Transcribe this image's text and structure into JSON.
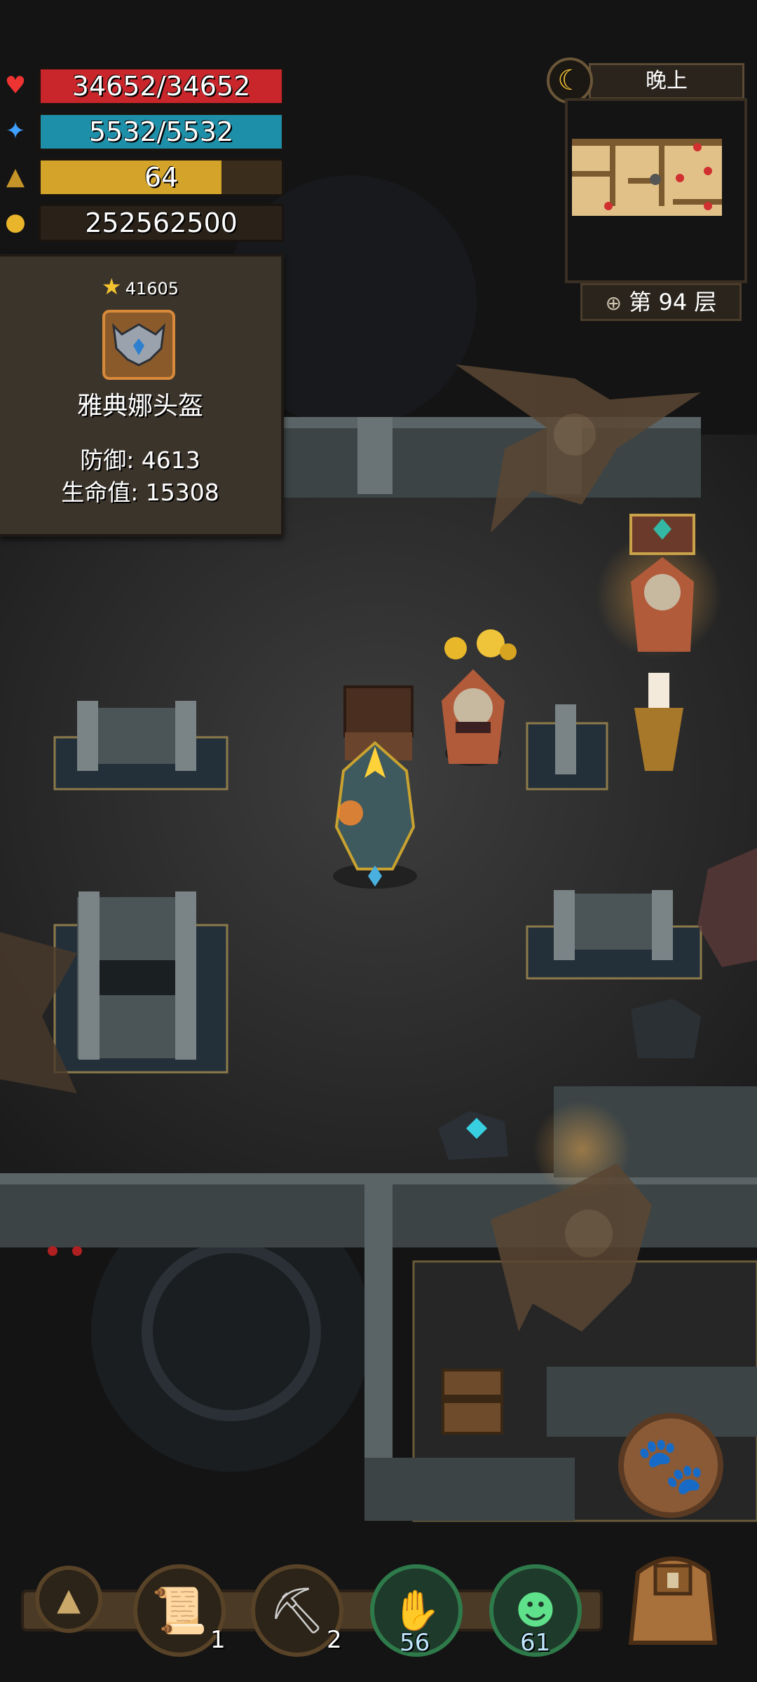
{
  "stats": {
    "hp": "34652/34652",
    "mp": "5532/5532",
    "level": "64",
    "gold": "252562500"
  },
  "colors": {
    "hp": "#c8262b",
    "mp": "#1e8fa8",
    "level": "#d3a32a",
    "gold": "#2a2219"
  },
  "item_popup": {
    "rating": "41605",
    "name": "雅典娜头盔",
    "defense": "防御: 4613",
    "health": "生命值: 15308"
  },
  "time_of_day": "晚上",
  "floor": "第 94 层",
  "toolbar": {
    "scroll_count": "1",
    "pickaxe_count": "2",
    "hand_skill_count": "56",
    "summon_skill_count": "61"
  }
}
